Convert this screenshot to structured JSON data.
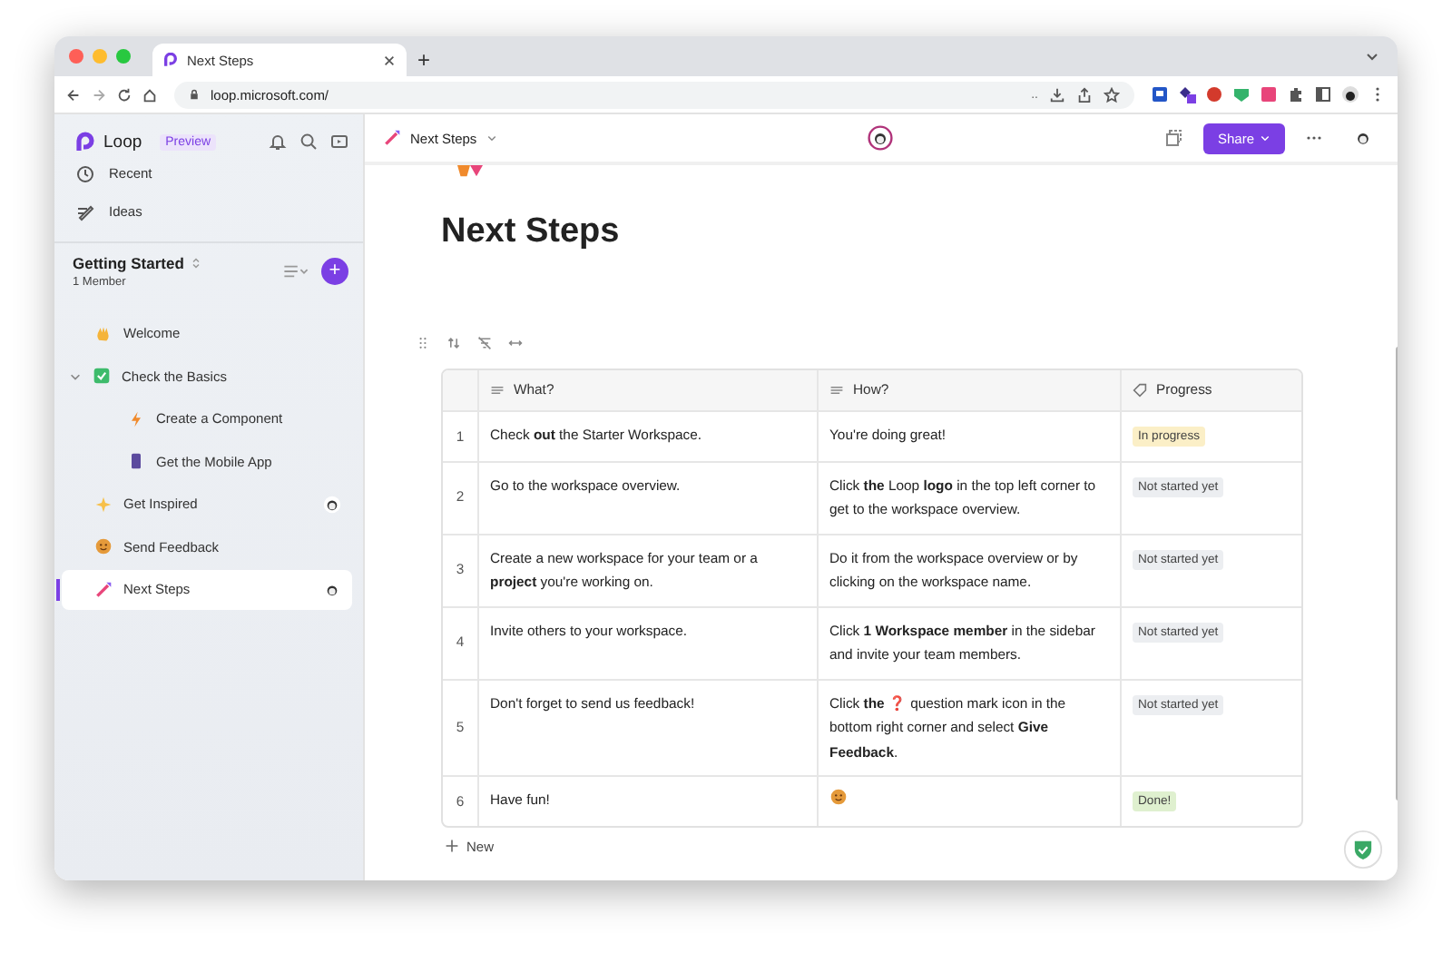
{
  "browser": {
    "tab_title": "Next Steps",
    "new_tab": "+",
    "url": "loop.microsoft.com/",
    "url_more": ".."
  },
  "sidebar": {
    "brand": "Loop",
    "badge": "Preview",
    "nav": [
      {
        "label": "Recent"
      },
      {
        "label": "Ideas"
      }
    ],
    "workspace": {
      "name": "Getting Started",
      "members": "1 Member",
      "add": "+"
    },
    "items": [
      {
        "label": "Welcome",
        "avatar": false,
        "selected": false
      },
      {
        "label": "Check the Basics",
        "avatar": false,
        "selected": false,
        "expanded": true,
        "children": [
          {
            "label": "Create a Component",
            "avatar": false,
            "selected": false
          },
          {
            "label": "Get the Mobile App",
            "avatar": false,
            "selected": false
          }
        ]
      },
      {
        "label": "Get Inspired",
        "avatar": true,
        "selected": false
      },
      {
        "label": "Send Feedback",
        "avatar": false,
        "selected": false
      },
      {
        "label": "Next Steps",
        "avatar": true,
        "selected": true
      }
    ]
  },
  "header": {
    "breadcrumb": "Next Steps",
    "share": "Share"
  },
  "page": {
    "title": "Next Steps"
  },
  "table": {
    "columns": [
      {
        "label": "What?"
      },
      {
        "label": "How?"
      },
      {
        "label": "Progress"
      }
    ],
    "rows": [
      {
        "number": "1",
        "what": "Check **out** the Starter Workspace.",
        "how": "You're doing great!",
        "status": "In progress",
        "color": "#fbefc7"
      },
      {
        "number": "2",
        "what": "Go to the workspace overview.",
        "how": "Click **the** Loop **logo** in the top left corner to get to the workspace overview.",
        "status": "Not started yet",
        "color": "#eceef1"
      },
      {
        "number": "3",
        "what": "Create a new workspace for your team or a **project** you're working on.",
        "how": "Do it from the workspace overview or by clicking on the workspace name.",
        "status": "Not started yet",
        "color": "#eceef1"
      },
      {
        "number": "4",
        "what": "Invite others to your workspace.",
        "how": "Click **1 Workspace member** in the sidebar and invite your team members.",
        "status": "Not started yet",
        "color": "#eceef1"
      },
      {
        "number": "5",
        "what": "Don't forget to send us feedback!",
        "how": "Click **the** ❓ question mark icon in the bottom right corner and select **Give Feedback**.",
        "status": "Not started yet",
        "color": "#eceef1"
      },
      {
        "number": "6",
        "what": "Have fun!",
        "status": "Done!",
        "color": "#dff0cf"
      }
    ],
    "new_row": "New"
  }
}
